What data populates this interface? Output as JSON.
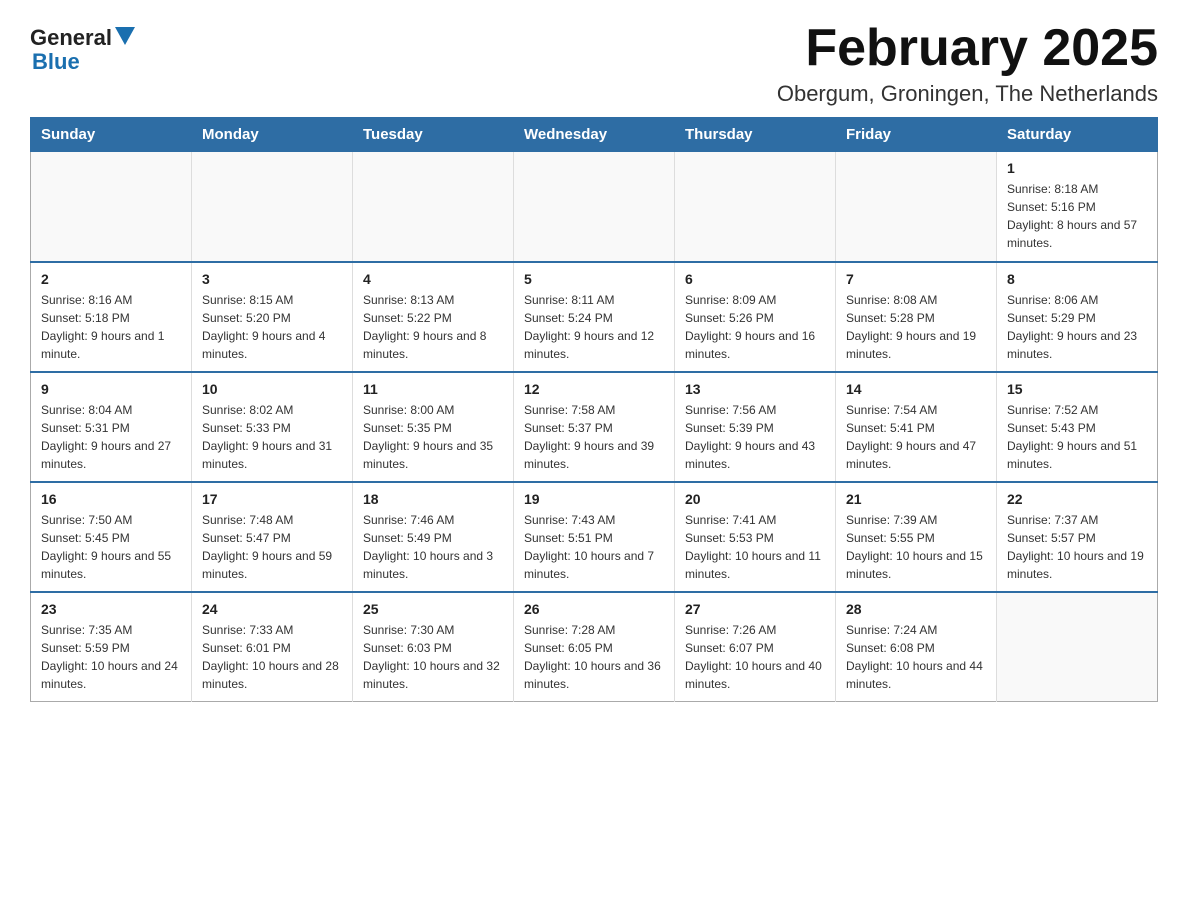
{
  "header": {
    "logo_general": "General",
    "logo_blue": "Blue",
    "title": "February 2025",
    "subtitle": "Obergum, Groningen, The Netherlands"
  },
  "days_of_week": [
    "Sunday",
    "Monday",
    "Tuesday",
    "Wednesday",
    "Thursday",
    "Friday",
    "Saturday"
  ],
  "weeks": [
    [
      {
        "day": "",
        "info": ""
      },
      {
        "day": "",
        "info": ""
      },
      {
        "day": "",
        "info": ""
      },
      {
        "day": "",
        "info": ""
      },
      {
        "day": "",
        "info": ""
      },
      {
        "day": "",
        "info": ""
      },
      {
        "day": "1",
        "info": "Sunrise: 8:18 AM\nSunset: 5:16 PM\nDaylight: 8 hours and 57 minutes."
      }
    ],
    [
      {
        "day": "2",
        "info": "Sunrise: 8:16 AM\nSunset: 5:18 PM\nDaylight: 9 hours and 1 minute."
      },
      {
        "day": "3",
        "info": "Sunrise: 8:15 AM\nSunset: 5:20 PM\nDaylight: 9 hours and 4 minutes."
      },
      {
        "day": "4",
        "info": "Sunrise: 8:13 AM\nSunset: 5:22 PM\nDaylight: 9 hours and 8 minutes."
      },
      {
        "day": "5",
        "info": "Sunrise: 8:11 AM\nSunset: 5:24 PM\nDaylight: 9 hours and 12 minutes."
      },
      {
        "day": "6",
        "info": "Sunrise: 8:09 AM\nSunset: 5:26 PM\nDaylight: 9 hours and 16 minutes."
      },
      {
        "day": "7",
        "info": "Sunrise: 8:08 AM\nSunset: 5:28 PM\nDaylight: 9 hours and 19 minutes."
      },
      {
        "day": "8",
        "info": "Sunrise: 8:06 AM\nSunset: 5:29 PM\nDaylight: 9 hours and 23 minutes."
      }
    ],
    [
      {
        "day": "9",
        "info": "Sunrise: 8:04 AM\nSunset: 5:31 PM\nDaylight: 9 hours and 27 minutes."
      },
      {
        "day": "10",
        "info": "Sunrise: 8:02 AM\nSunset: 5:33 PM\nDaylight: 9 hours and 31 minutes."
      },
      {
        "day": "11",
        "info": "Sunrise: 8:00 AM\nSunset: 5:35 PM\nDaylight: 9 hours and 35 minutes."
      },
      {
        "day": "12",
        "info": "Sunrise: 7:58 AM\nSunset: 5:37 PM\nDaylight: 9 hours and 39 minutes."
      },
      {
        "day": "13",
        "info": "Sunrise: 7:56 AM\nSunset: 5:39 PM\nDaylight: 9 hours and 43 minutes."
      },
      {
        "day": "14",
        "info": "Sunrise: 7:54 AM\nSunset: 5:41 PM\nDaylight: 9 hours and 47 minutes."
      },
      {
        "day": "15",
        "info": "Sunrise: 7:52 AM\nSunset: 5:43 PM\nDaylight: 9 hours and 51 minutes."
      }
    ],
    [
      {
        "day": "16",
        "info": "Sunrise: 7:50 AM\nSunset: 5:45 PM\nDaylight: 9 hours and 55 minutes."
      },
      {
        "day": "17",
        "info": "Sunrise: 7:48 AM\nSunset: 5:47 PM\nDaylight: 9 hours and 59 minutes."
      },
      {
        "day": "18",
        "info": "Sunrise: 7:46 AM\nSunset: 5:49 PM\nDaylight: 10 hours and 3 minutes."
      },
      {
        "day": "19",
        "info": "Sunrise: 7:43 AM\nSunset: 5:51 PM\nDaylight: 10 hours and 7 minutes."
      },
      {
        "day": "20",
        "info": "Sunrise: 7:41 AM\nSunset: 5:53 PM\nDaylight: 10 hours and 11 minutes."
      },
      {
        "day": "21",
        "info": "Sunrise: 7:39 AM\nSunset: 5:55 PM\nDaylight: 10 hours and 15 minutes."
      },
      {
        "day": "22",
        "info": "Sunrise: 7:37 AM\nSunset: 5:57 PM\nDaylight: 10 hours and 19 minutes."
      }
    ],
    [
      {
        "day": "23",
        "info": "Sunrise: 7:35 AM\nSunset: 5:59 PM\nDaylight: 10 hours and 24 minutes."
      },
      {
        "day": "24",
        "info": "Sunrise: 7:33 AM\nSunset: 6:01 PM\nDaylight: 10 hours and 28 minutes."
      },
      {
        "day": "25",
        "info": "Sunrise: 7:30 AM\nSunset: 6:03 PM\nDaylight: 10 hours and 32 minutes."
      },
      {
        "day": "26",
        "info": "Sunrise: 7:28 AM\nSunset: 6:05 PM\nDaylight: 10 hours and 36 minutes."
      },
      {
        "day": "27",
        "info": "Sunrise: 7:26 AM\nSunset: 6:07 PM\nDaylight: 10 hours and 40 minutes."
      },
      {
        "day": "28",
        "info": "Sunrise: 7:24 AM\nSunset: 6:08 PM\nDaylight: 10 hours and 44 minutes."
      },
      {
        "day": "",
        "info": ""
      }
    ]
  ]
}
